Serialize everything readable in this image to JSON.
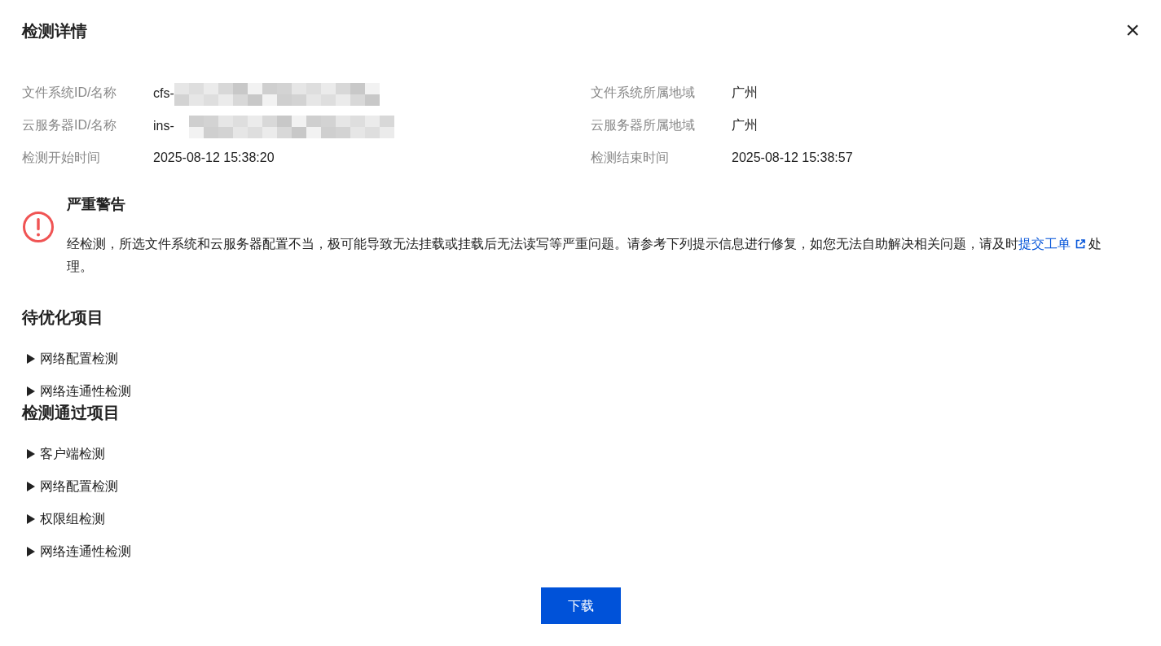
{
  "dialog": {
    "title": "检测详情",
    "close": "×"
  },
  "info": [
    {
      "label": "文件系统ID/名称",
      "value": "cfs-",
      "redacted": true
    },
    {
      "label": "文件系统所属地域",
      "value": "广州",
      "redacted": false
    },
    {
      "label": "云服务器ID/名称",
      "value": "ins-",
      "redacted": true
    },
    {
      "label": "云服务器所属地域",
      "value": "广州",
      "redacted": false
    },
    {
      "label": "检测开始时间",
      "value": "2025-08-12 15:38:20",
      "redacted": false
    },
    {
      "label": "检测结束时间",
      "value": "2025-08-12 15:38:57",
      "redacted": false
    }
  ],
  "alert": {
    "title": "严重警告",
    "text_before": "经检测，所选文件系统和云服务器配置不当，极可能导致无法挂载或挂载后无法读写等严重问题。请参考下列提示信息进行修复，如您无法自助解决相关问题，请及时",
    "link": "提交工单",
    "text_after": "处理。"
  },
  "sections": [
    {
      "title": "待优化项目",
      "items": [
        {
          "label": "网络配置检测",
          "expanded": false
        },
        {
          "label": "网络连通性检测",
          "expanded": false
        }
      ]
    },
    {
      "title": "检测通过项目",
      "items": [
        {
          "label": "客户端检测",
          "expanded": false
        },
        {
          "label": "网络配置检测",
          "expanded": false
        },
        {
          "label": "权限组检测",
          "expanded": false
        },
        {
          "label": "网络连通性检测",
          "expanded": false
        }
      ]
    }
  ],
  "buttons": [
    {
      "label": "下载",
      "kind": "primary"
    }
  ]
}
